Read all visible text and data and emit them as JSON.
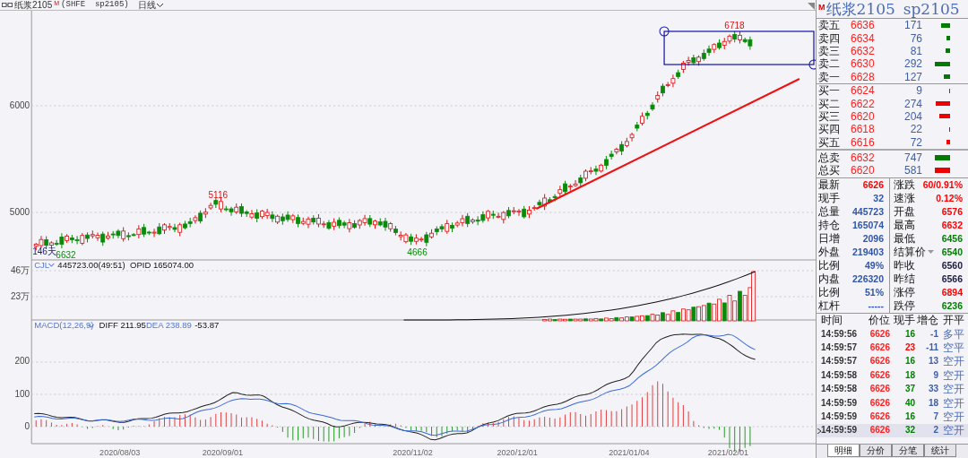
{
  "header": {
    "name": "纸浆2105",
    "flag": "M",
    "code": "(SHFE  sp2105)",
    "period": "日线"
  },
  "main_chart": {
    "y_labels": [
      "6000",
      "5000"
    ],
    "annotations": [
      {
        "text": "6718",
        "kind": "high"
      },
      {
        "text": "5116",
        "kind": "high"
      },
      {
        "text": "146天",
        "kind": "span"
      },
      {
        "text": "6632",
        "kind": "low"
      },
      {
        "text": "4666",
        "kind": "low"
      }
    ]
  },
  "volume_panel": {
    "indicator": "CJL",
    "readout": "445723.00(49:51)  OPID 165074.00",
    "y_labels": [
      "46万",
      "23万"
    ]
  },
  "macd_panel": {
    "indicator": "MACD(12,26,9)",
    "diff": "DIFF 211.95",
    "dea": "DEA 238.89",
    "macd": "-53.87",
    "y_labels": [
      "200",
      "100",
      "0"
    ]
  },
  "x_labels": [
    "2020/08/03",
    "2020/09/01",
    "2020/11/02",
    "2020/12/01",
    "2021/01/04",
    "2021/02/01"
  ],
  "quote": {
    "flag": "M",
    "name": "纸浆2105",
    "code": "sp2105",
    "asks": [
      {
        "label": "卖五",
        "price": "6636",
        "volume": "171"
      },
      {
        "label": "卖四",
        "price": "6634",
        "volume": "76"
      },
      {
        "label": "卖三",
        "price": "6632",
        "volume": "81"
      },
      {
        "label": "卖二",
        "price": "6630",
        "volume": "292"
      },
      {
        "label": "卖一",
        "price": "6628",
        "volume": "127"
      }
    ],
    "bids": [
      {
        "label": "买一",
        "price": "6624",
        "volume": "9"
      },
      {
        "label": "买二",
        "price": "6622",
        "volume": "274"
      },
      {
        "label": "买三",
        "price": "6620",
        "volume": "204"
      },
      {
        "label": "买四",
        "price": "6618",
        "volume": "22"
      },
      {
        "label": "买五",
        "price": "6616",
        "volume": "72"
      }
    ],
    "totals": [
      {
        "label": "总卖",
        "price": "6632",
        "volume": "747",
        "color": "#007a00"
      },
      {
        "label": "总买",
        "price": "6620",
        "volume": "581",
        "color": "#ee0000"
      }
    ],
    "stats_left": [
      {
        "label": "最新",
        "value": "6626",
        "color": "#ff0000"
      },
      {
        "label": "现手",
        "value": "32",
        "color": "#2f55a8"
      },
      {
        "label": "总量",
        "value": "445723",
        "color": "#2f55a8"
      },
      {
        "label": "持仓",
        "value": "165074",
        "color": "#2f55a8"
      },
      {
        "label": "日增",
        "value": "2096",
        "color": "#2f55a8"
      },
      {
        "label": "外盘",
        "value": "219403",
        "color": "#2f55a8"
      },
      {
        "label": "比例",
        "value": "49%",
        "color": "#2f55a8"
      },
      {
        "label": "内盘",
        "value": "226320",
        "color": "#2f55a8"
      },
      {
        "label": "比例",
        "value": "51%",
        "color": "#2f55a8"
      },
      {
        "label": "杠杆",
        "value": "-----",
        "color": "#2f55a8"
      }
    ],
    "stats_right": [
      {
        "label": "涨跌",
        "value": "60/0.91%",
        "color": "#ff0000",
        "dropdown": false
      },
      {
        "label": "速涨",
        "value": "0.12%",
        "color": "#ff0000",
        "dropdown": false
      },
      {
        "label": "开盘",
        "value": "6576",
        "color": "#ff0000",
        "dropdown": false
      },
      {
        "label": "最高",
        "value": "6632",
        "color": "#ff0000",
        "dropdown": false
      },
      {
        "label": "最低",
        "value": "6456",
        "color": "#008000",
        "dropdown": false
      },
      {
        "label": "结算价",
        "value": "6540",
        "color": "#008000",
        "dropdown": true
      },
      {
        "label": "昨收",
        "value": "6560",
        "color": "#1a1a40",
        "dropdown": false
      },
      {
        "label": "昨结",
        "value": "6566",
        "color": "#1a1a40",
        "dropdown": false
      },
      {
        "label": "涨停",
        "value": "6894",
        "color": "#ff0000",
        "dropdown": false
      },
      {
        "label": "跌停",
        "value": "6236",
        "color": "#008000",
        "dropdown": false
      }
    ],
    "trades": {
      "columns": [
        "时间",
        "价位",
        "现手",
        "增仓",
        "开平"
      ],
      "rows": [
        {
          "time": "14:59:56",
          "price": "6626",
          "hand": "16",
          "color": "#008000",
          "change": "-1",
          "type": "多平",
          "selected": false
        },
        {
          "time": "14:59:57",
          "price": "6626",
          "hand": "23",
          "color": "#ff0000",
          "change": "-11",
          "type": "空平",
          "selected": false
        },
        {
          "time": "14:59:57",
          "price": "6626",
          "hand": "16",
          "color": "#008000",
          "change": "13",
          "type": "空开",
          "selected": false
        },
        {
          "time": "14:59:58",
          "price": "6626",
          "hand": "18",
          "color": "#008000",
          "change": "9",
          "type": "空开",
          "selected": false
        },
        {
          "time": "14:59:58",
          "price": "6626",
          "hand": "37",
          "color": "#008000",
          "change": "33",
          "type": "空开",
          "selected": false
        },
        {
          "time": "14:59:59",
          "price": "6626",
          "hand": "40",
          "color": "#008000",
          "change": "18",
          "type": "空开",
          "selected": false
        },
        {
          "time": "14:59:59",
          "price": "6626",
          "hand": "16",
          "color": "#008000",
          "change": "7",
          "type": "空开",
          "selected": false
        },
        {
          "time": "14:59:59",
          "price": "6626",
          "hand": "32",
          "color": "#008000",
          "change": "2",
          "type": "空开",
          "selected": true
        }
      ]
    },
    "tabs": [
      {
        "label": "明细",
        "selected": true
      },
      {
        "label": "分价",
        "selected": false
      },
      {
        "label": "分笔",
        "selected": false
      },
      {
        "label": "统计",
        "selected": false
      }
    ]
  }
}
